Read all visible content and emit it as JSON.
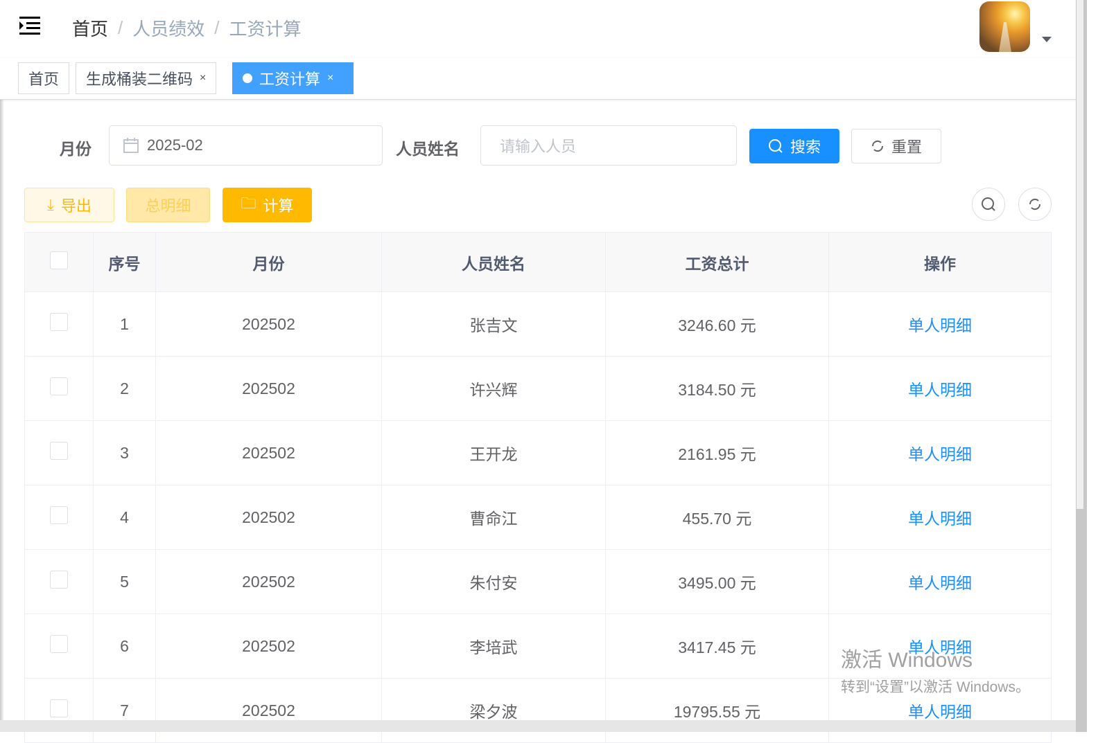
{
  "breadcrumb": [
    "首页",
    "人员绩效",
    "工资计算"
  ],
  "tabs": [
    {
      "label": "首页"
    },
    {
      "label": "生成桶装二维码",
      "close": "×"
    },
    {
      "label": "工资计算",
      "close": "×",
      "active": true
    }
  ],
  "search": {
    "month_label": "月份",
    "month_value": "2025-02",
    "name_label": "人员姓名",
    "name_placeholder": "请输入人员",
    "search_btn": "搜索",
    "reset_btn": "重置"
  },
  "toolbar": {
    "export": "导出",
    "summary": "总明细",
    "calculate": "计算"
  },
  "table": {
    "headers": [
      "序号",
      "月份",
      "人员姓名",
      "工资总计",
      "操作"
    ],
    "rows": [
      {
        "no": "1",
        "month": "202502",
        "name": "张吉文",
        "total": "3246.60 元",
        "action": "单人明细"
      },
      {
        "no": "2",
        "month": "202502",
        "name": "许兴辉",
        "total": "3184.50 元",
        "action": "单人明细"
      },
      {
        "no": "3",
        "month": "202502",
        "name": "王开龙",
        "total": "2161.95 元",
        "action": "单人明细"
      },
      {
        "no": "4",
        "month": "202502",
        "name": "曹命江",
        "total": "455.70 元",
        "action": "单人明细"
      },
      {
        "no": "5",
        "month": "202502",
        "name": "朱付安",
        "total": "3495.00 元",
        "action": "单人明细"
      },
      {
        "no": "6",
        "month": "202502",
        "name": "李培武",
        "total": "3417.45 元",
        "action": "单人明细"
      },
      {
        "no": "7",
        "month": "202502",
        "name": "梁夕波",
        "total": "19795.55 元",
        "action": "单人明细"
      }
    ]
  },
  "watermark": {
    "line1": "激活 Windows",
    "line2": "转到“设置”以激活 Windows。"
  },
  "colors": {
    "primary": "#1890ff",
    "warning": "#ffba00",
    "tag_active": "#42a0ff"
  }
}
